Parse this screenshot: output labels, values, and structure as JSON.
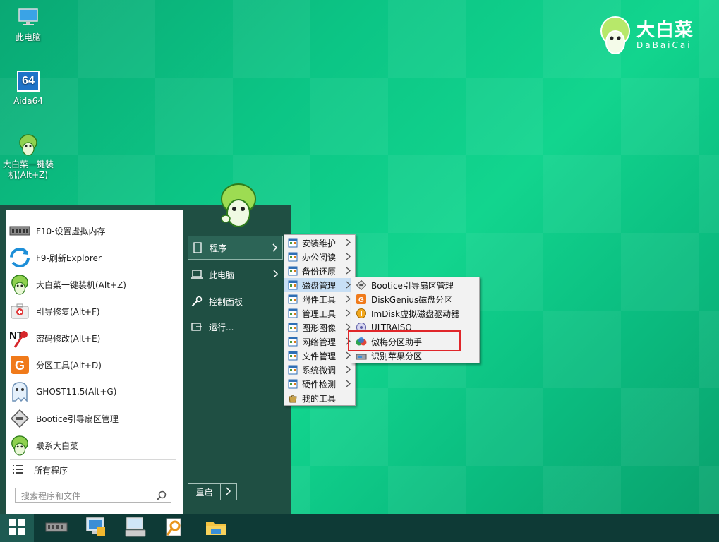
{
  "desktop": {
    "icons": [
      {
        "label": "此电脑",
        "icon": "computer-icon"
      },
      {
        "label": "Aida64",
        "icon": "aida64-icon",
        "badge": "64"
      },
      {
        "label": "大白菜一键装机(Alt+Z)",
        "icon": "dabaicai-icon"
      }
    ],
    "brand": {
      "name": "大白菜",
      "sub": "DaBaiCai"
    }
  },
  "start_menu": {
    "left_items": [
      {
        "label": "F10-设置虚拟内存",
        "icon": "memory-chip-icon"
      },
      {
        "label": "F9-刷新Explorer",
        "icon": "refresh-icon"
      },
      {
        "label": "大白菜一键装机(Alt+Z)",
        "icon": "dabaicai-icon"
      },
      {
        "label": "引导修复(Alt+F)",
        "icon": "first-aid-icon"
      },
      {
        "label": "密码修改(Alt+E)",
        "icon": "ntpwd-key-icon"
      },
      {
        "label": "分区工具(Alt+D)",
        "icon": "diskgenius-icon"
      },
      {
        "label": "GHOST11.5(Alt+G)",
        "icon": "ghost-icon"
      },
      {
        "label": "Bootice引导扇区管理",
        "icon": "bootice-icon"
      },
      {
        "label": "联系大白菜",
        "icon": "dabaicai-icon"
      }
    ],
    "all_programs": "所有程序",
    "search_placeholder": "搜索程序和文件",
    "right_items": [
      {
        "label": "程序",
        "icon": "programs-icon",
        "active": true,
        "has_arrow": true
      },
      {
        "label": "此电脑",
        "icon": "laptop-icon",
        "has_arrow": true
      },
      {
        "label": "控制面板",
        "icon": "wrench-icon"
      },
      {
        "label": "运行...",
        "icon": "run-icon"
      }
    ],
    "restart_label": "重启"
  },
  "programs_submenu": [
    {
      "label": "安装维护"
    },
    {
      "label": "办公阅读"
    },
    {
      "label": "备份还原"
    },
    {
      "label": "磁盘管理",
      "selected": true
    },
    {
      "label": "附件工具"
    },
    {
      "label": "管理工具"
    },
    {
      "label": "图形图像"
    },
    {
      "label": "网络管理"
    },
    {
      "label": "文件管理"
    },
    {
      "label": "系统微调"
    },
    {
      "label": "硬件检测"
    },
    {
      "label": "我的工具",
      "no_arrow": true
    }
  ],
  "disk_submenu": [
    {
      "label": "Bootice引导扇区管理",
      "icon": "bootice-icon"
    },
    {
      "label": "DiskGenius磁盘分区",
      "icon": "diskgenius-icon"
    },
    {
      "label": "ImDisk虚拟磁盘驱动器",
      "icon": "imdisk-icon"
    },
    {
      "label": "ULTRAISO",
      "icon": "ultraiso-icon"
    },
    {
      "label": "傲梅分区助手",
      "icon": "aomei-icon",
      "highlighted": true
    },
    {
      "label": "识别苹果分区",
      "icon": "apple-partition-icon"
    }
  ],
  "taskbar": {
    "buttons": [
      "windows-start-icon",
      "memory-chip-icon",
      "network-monitor-icon",
      "keyboard-icon",
      "search-tool-icon",
      "folder-icon"
    ]
  },
  "colors": {
    "highlight_border": "#e0262a",
    "selected_bg": "#c7dff5",
    "start_panel": "#1f4f43"
  }
}
